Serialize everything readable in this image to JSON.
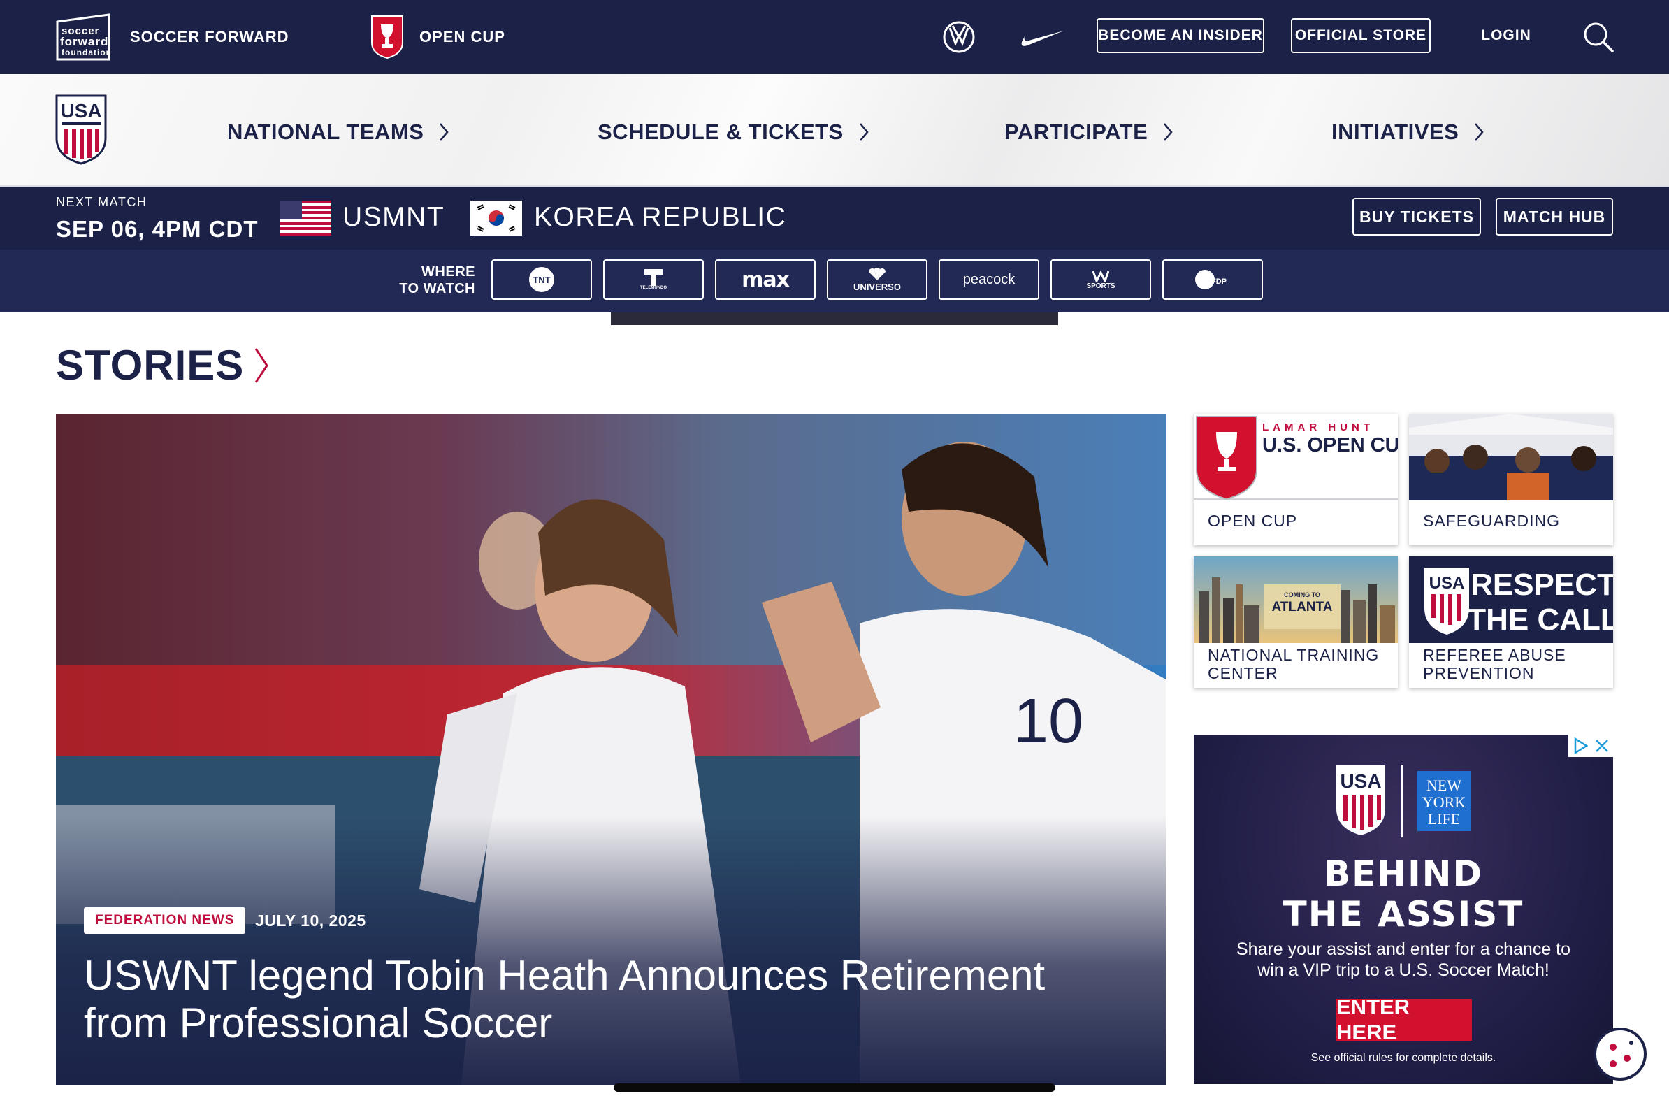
{
  "topbar": {
    "sff_label": "SOCCER FORWARD",
    "sff_logo_text": [
      "soccer",
      "forward",
      "foundation"
    ],
    "opencup_label": "OPEN CUP",
    "become_insider": "BECOME AN INSIDER",
    "official_store": "OFFICIAL STORE",
    "login": "LOGIN",
    "icons": [
      "volkswagen-logo-icon",
      "nike-swoosh-icon",
      "search-icon"
    ]
  },
  "mainnav": {
    "items": [
      {
        "label": "NATIONAL TEAMS"
      },
      {
        "label": "SCHEDULE & TICKETS"
      },
      {
        "label": "PARTICIPATE"
      },
      {
        "label": "INITIATIVES"
      }
    ]
  },
  "next_match": {
    "label": "NEXT MATCH",
    "datetime": "SEP 06, 4PM CDT",
    "home_team": "USMNT",
    "away_team": "KOREA REPUBLIC",
    "buy_tickets": "BUY TICKETS",
    "match_hub": "MATCH HUB"
  },
  "where_to_watch": {
    "label_line1": "WHERE",
    "label_line2": "TO WATCH",
    "broadcasters": [
      {
        "name": "TNT",
        "text": "TNT"
      },
      {
        "name": "Telemundo",
        "text": "TELEMUNDO"
      },
      {
        "name": "Max",
        "text": "max"
      },
      {
        "name": "Universo",
        "text": "UNIVERSO"
      },
      {
        "name": "Peacock",
        "text": "peacock"
      },
      {
        "name": "Westwood One Sports",
        "text": "SPORTS"
      },
      {
        "name": "FDP",
        "text": "FDP"
      }
    ]
  },
  "stories": {
    "heading": "STORIES",
    "hero": {
      "tag": "FEDERATION NEWS",
      "date": "JULY 10, 2025",
      "headline": "USWNT legend Tobin Heath Announces Retirement from Professional Soccer"
    },
    "tiles": [
      {
        "label": "OPEN CUP",
        "thumb_text_1": "LAMAR HUNT",
        "thumb_text_2": "U.S. OPEN CUP"
      },
      {
        "label": "SAFEGUARDING"
      },
      {
        "label": "NATIONAL TRAINING CENTER",
        "thumb_text_1": "COMING TO",
        "thumb_text_2": "ATLANTA"
      },
      {
        "label": "REFEREE ABUSE PREVENTION",
        "thumb_text_1": "RESPECT",
        "thumb_text_2": "THE CALL"
      }
    ]
  },
  "ad": {
    "headline_1": "BEHIND",
    "headline_2": "THE ASSIST",
    "body": "Share your assist and enter for a chance to win a VIP trip to a U.S. Soccer Match!",
    "cta": "ENTER HERE",
    "fine_print": "See official rules for complete details.",
    "partner_text": [
      "NEW",
      "YORK",
      "LIFE"
    ]
  },
  "colors": {
    "navy": "#1b2147",
    "red": "#bf0d3e",
    "white": "#ffffff"
  }
}
